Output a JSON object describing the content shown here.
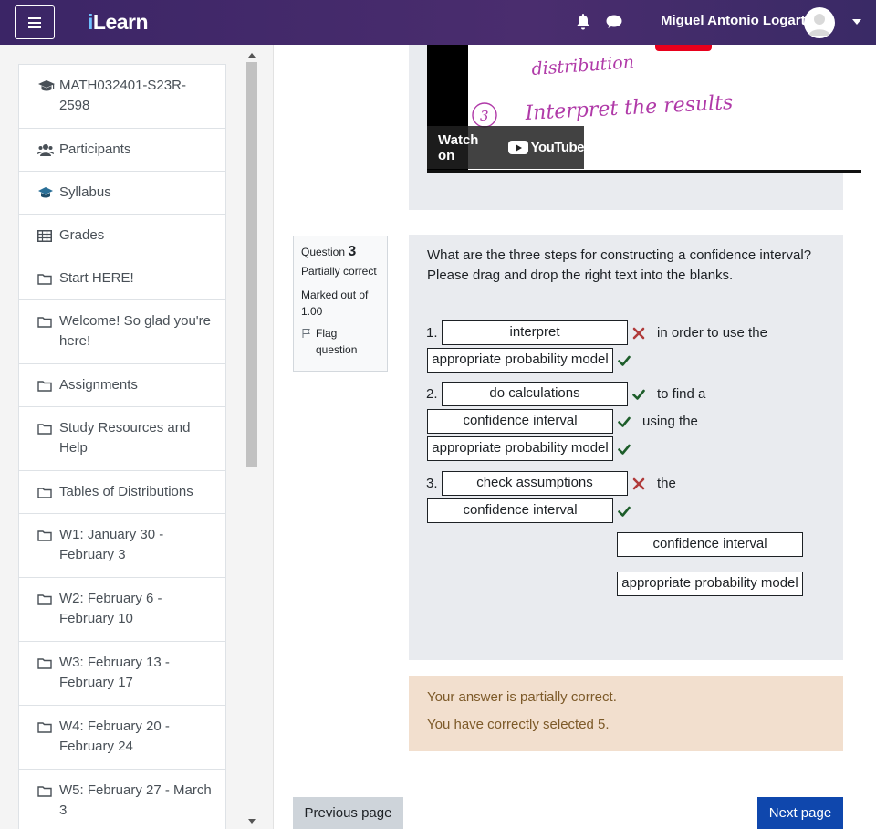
{
  "header": {
    "logo": "iLearn",
    "logo_i": "i",
    "logo_rest": "Learn",
    "user_name": "Miguel Antonio Logarta",
    "icons": [
      "menu-icon",
      "bell-icon",
      "chat-icon",
      "avatar",
      "chevron-down-icon"
    ]
  },
  "sidebar": {
    "items": [
      {
        "label": "MATH032401-S23R-2598",
        "icon": "graduation-cap-icon"
      },
      {
        "label": "Participants",
        "icon": "users-icon"
      },
      {
        "label": "Syllabus",
        "icon": "mortarboard-icon"
      },
      {
        "label": "Grades",
        "icon": "table-icon"
      },
      {
        "label": "Start HERE!",
        "icon": "folder-icon"
      },
      {
        "label": "Welcome! So glad you're here!",
        "icon": "folder-icon"
      },
      {
        "label": "Assignments",
        "icon": "folder-icon"
      },
      {
        "label": "Study Resources and Help",
        "icon": "folder-icon"
      },
      {
        "label": "Tables of Distributions",
        "icon": "folder-icon"
      },
      {
        "label": "W1: January 30 - February 3",
        "icon": "folder-icon"
      },
      {
        "label": "W2: February 6 - February 10",
        "icon": "folder-icon"
      },
      {
        "label": "W3: February 13 - February 17",
        "icon": "folder-icon"
      },
      {
        "label": "W4: February 20 - February 24",
        "icon": "folder-icon"
      },
      {
        "label": "W5: February 27 - March 3",
        "icon": "folder-icon"
      }
    ]
  },
  "video": {
    "handwriting": [
      "distribution",
      "3",
      "Interpret the results"
    ],
    "watch_label": "Watch on",
    "youtube_label": "YouTube"
  },
  "question": {
    "label": "Question",
    "number": "3",
    "state": "Partially correct",
    "marked_out_of": "Marked out of 1.00",
    "flag_label": "Flag question",
    "prompt": "What are the three steps for constructing a confidence interval? Please drag and drop the right text into the blanks.",
    "steps": {
      "s1_number": "1.",
      "s1_drop1": "interpret",
      "s1_text1": "in order to use the",
      "s1_drop2": "appropriate probability model",
      "s2_number": "2.",
      "s2_drop1": "do calculations",
      "s2_text1": "to find a",
      "s2_drop2": "confidence interval",
      "s2_text2": "using the",
      "s2_drop3": "appropriate probability model",
      "s3_number": "3.",
      "s3_drop1": "check assumptions",
      "s3_text1": "the",
      "s3_drop2": "confidence interval"
    },
    "marks": {
      "s1_drop1": "incorrect",
      "s1_drop2": "correct",
      "s2_drop1": "correct",
      "s2_drop2": "correct",
      "s2_drop3": "correct",
      "s3_drop1": "incorrect",
      "s3_drop2": "correct"
    },
    "choices": [
      "confidence interval",
      "appropriate probability model"
    ]
  },
  "feedback": {
    "line1": "Your answer is partially correct.",
    "line2": "You have correctly selected 5."
  },
  "navigation": {
    "prev_label": "Previous page",
    "next_label": "Next page"
  },
  "colors": {
    "navbar": "#4a2d6e",
    "correct": "#1d5d2a",
    "incorrect": "#b03a3a",
    "feedback_bg": "#f2dfce",
    "next_button": "#0f47ad"
  }
}
